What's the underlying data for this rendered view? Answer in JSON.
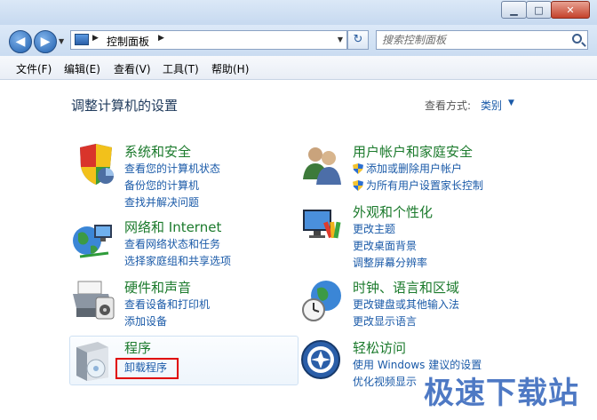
{
  "window": {
    "min_glyph": "▁",
    "max_glyph": "□",
    "close_glyph": "✕"
  },
  "address": {
    "crumb": "控制面板",
    "back_glyph": "◀",
    "fwd_glyph": "▶",
    "arrow_glyph": "▶",
    "drop_glyph": "▼",
    "refresh_glyph": "↻"
  },
  "search": {
    "placeholder": "搜索控制面板"
  },
  "menu": {
    "items": [
      "文件(F)",
      "编辑(E)",
      "查看(V)",
      "工具(T)",
      "帮助(H)"
    ]
  },
  "header": {
    "title": "调整计算机的设置",
    "view_label": "查看方式:",
    "view_value": "类别",
    "view_arrow": "▼"
  },
  "categories": {
    "system": {
      "title": "系统和安全",
      "links": [
        "查看您的计算机状态",
        "备份您的计算机",
        "查找并解决问题"
      ]
    },
    "accounts": {
      "title": "用户帐户和家庭安全",
      "links": [
        "添加或删除用户帐户",
        "为所有用户设置家长控制"
      ]
    },
    "network": {
      "title": "网络和 Internet",
      "links": [
        "查看网络状态和任务",
        "选择家庭组和共享选项"
      ]
    },
    "appearance": {
      "title": "外观和个性化",
      "links": [
        "更改主题",
        "更改桌面背景",
        "调整屏幕分辨率"
      ]
    },
    "hardware": {
      "title": "硬件和声音",
      "links": [
        "查看设备和打印机",
        "添加设备"
      ]
    },
    "clock": {
      "title": "时钟、语言和区域",
      "links": [
        "更改键盘或其他输入法",
        "更改显示语言"
      ]
    },
    "programs": {
      "title": "程序",
      "links": [
        "卸载程序"
      ]
    },
    "ease": {
      "title": "轻松访问",
      "links": [
        "使用 Windows 建议的设置",
        "优化视频显示"
      ]
    }
  },
  "watermark": {
    "text": "极速下载站"
  },
  "colors": {
    "accent": "#1a5aa8",
    "category_title": "#1b7a2c",
    "highlight": "#e00000",
    "watermark": "#4e79c4"
  }
}
